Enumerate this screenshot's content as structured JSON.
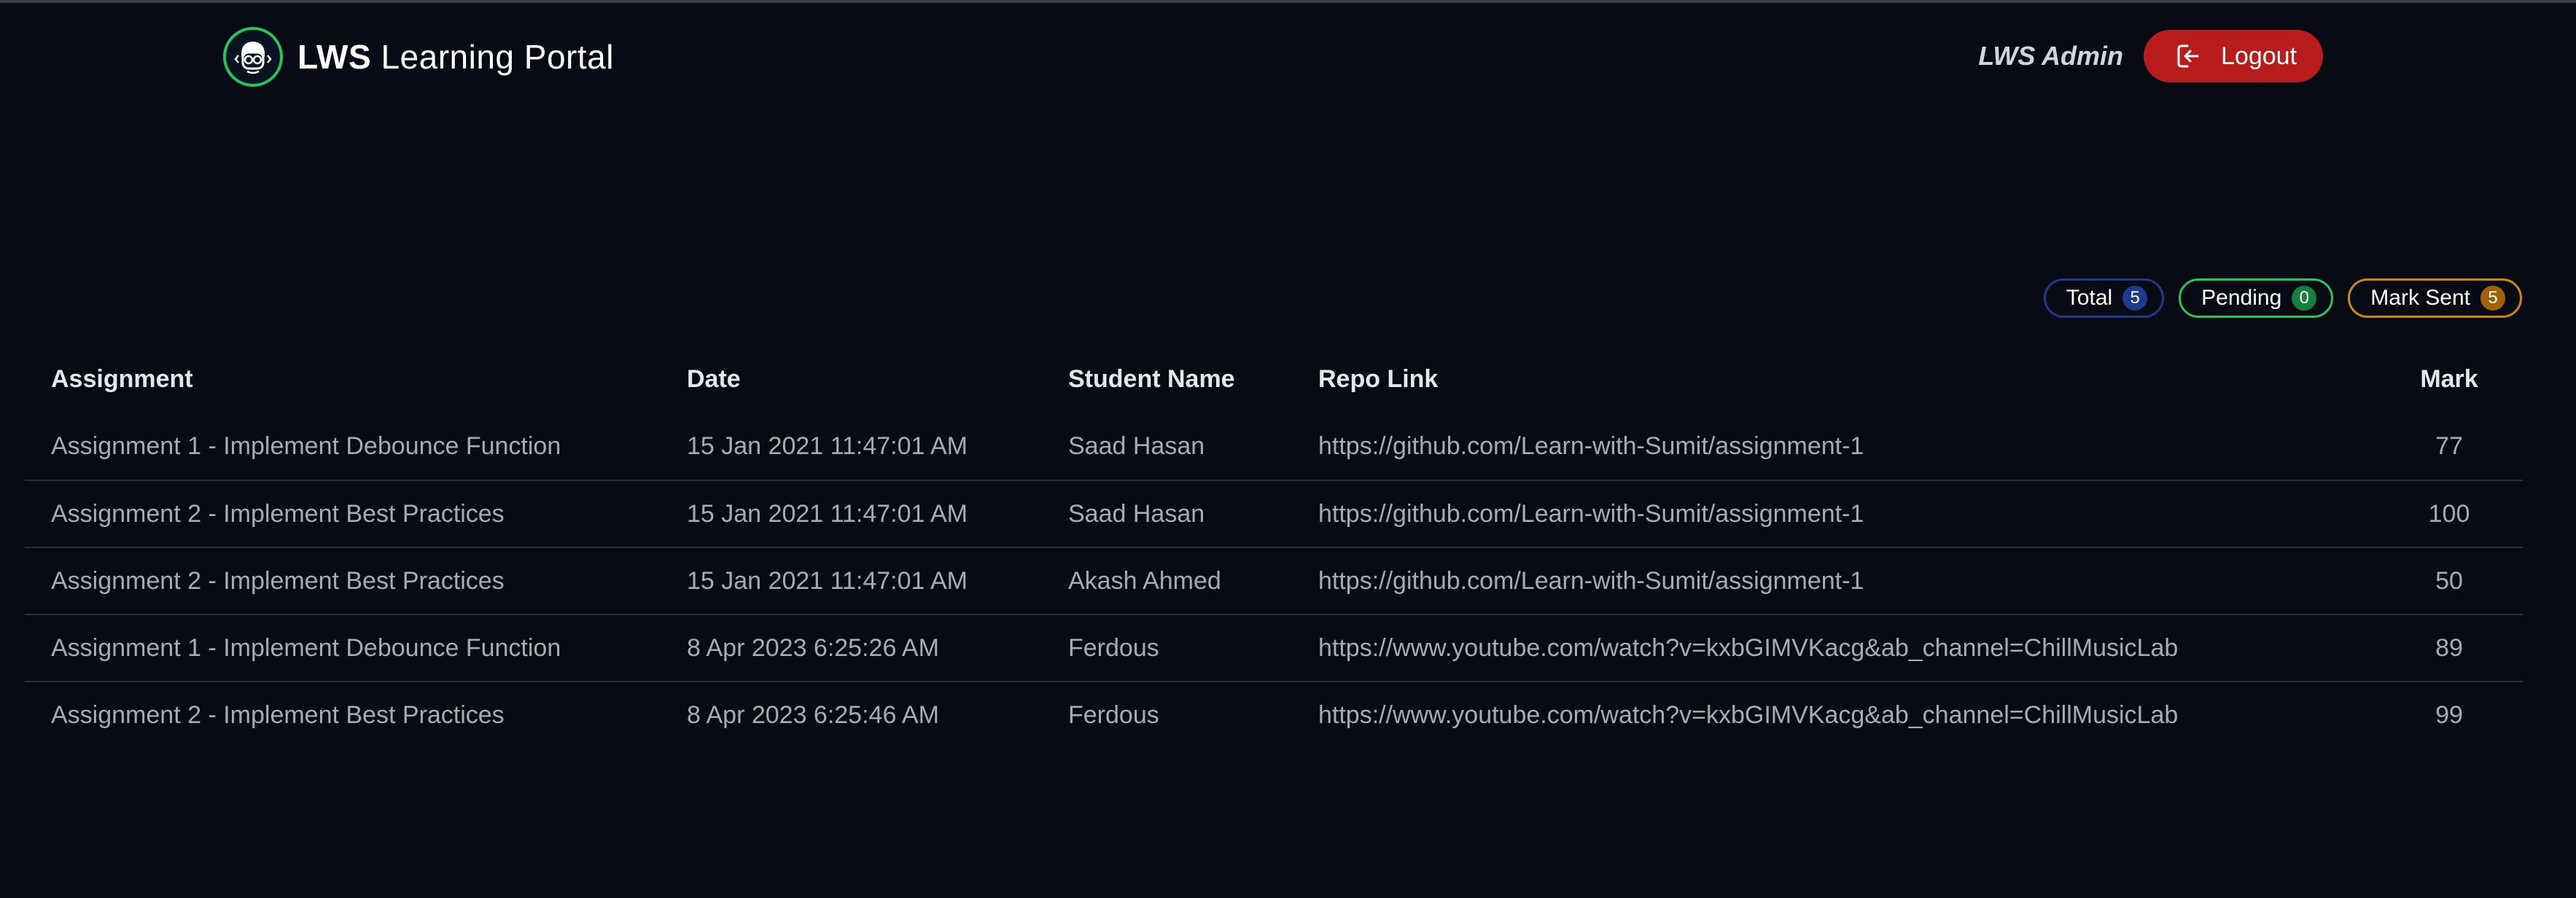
{
  "header": {
    "brand_bold": "LWS",
    "brand_rest": " Learning Portal",
    "admin_name": "LWS Admin",
    "logout_label": "Logout"
  },
  "badges": {
    "total_label": "Total",
    "total_count": "5",
    "pending_label": "Pending",
    "pending_count": "0",
    "mark_sent_label": "Mark Sent",
    "mark_sent_count": "5"
  },
  "table": {
    "columns": [
      "Assignment",
      "Date",
      "Student Name",
      "Repo Link",
      "Mark"
    ],
    "rows": [
      {
        "assignment": "Assignment 1 - Implement Debounce Function",
        "date": "15 Jan 2021 11:47:01 AM",
        "student": "Saad Hasan",
        "repo": "https://github.com/Learn-with-Sumit/assignment-1",
        "mark": "77"
      },
      {
        "assignment": "Assignment 2 - Implement Best Practices",
        "date": "15 Jan 2021 11:47:01 AM",
        "student": "Saad Hasan",
        "repo": "https://github.com/Learn-with-Sumit/assignment-1",
        "mark": "100"
      },
      {
        "assignment": "Assignment 2 - Implement Best Practices",
        "date": "15 Jan 2021 11:47:01 AM",
        "student": "Akash Ahmed",
        "repo": "https://github.com/Learn-with-Sumit/assignment-1",
        "mark": "50"
      },
      {
        "assignment": "Assignment 1 - Implement Debounce Function",
        "date": "8 Apr 2023 6:25:26 AM",
        "student": "Ferdous",
        "repo": "https://www.youtube.com/watch?v=kxbGIMVKacg&ab_channel=ChillMusicLab",
        "mark": "89"
      },
      {
        "assignment": "Assignment 2 - Implement Best Practices",
        "date": "8 Apr 2023 6:25:46 AM",
        "student": "Ferdous",
        "repo": "https://www.youtube.com/watch?v=kxbGIMVKacg&ab_channel=ChillMusicLab",
        "mark": "99"
      }
    ]
  },
  "colors": {
    "background": "#080b14",
    "logout": "#b91c1c",
    "total_badge": "#1e3a8a",
    "pending_badge": "#22c55e",
    "mark_sent_badge": "#ca8a04",
    "logo_ring": "#22c55e"
  },
  "icons": {
    "logo": "developer-avatar-icon",
    "logout": "logout-icon"
  }
}
